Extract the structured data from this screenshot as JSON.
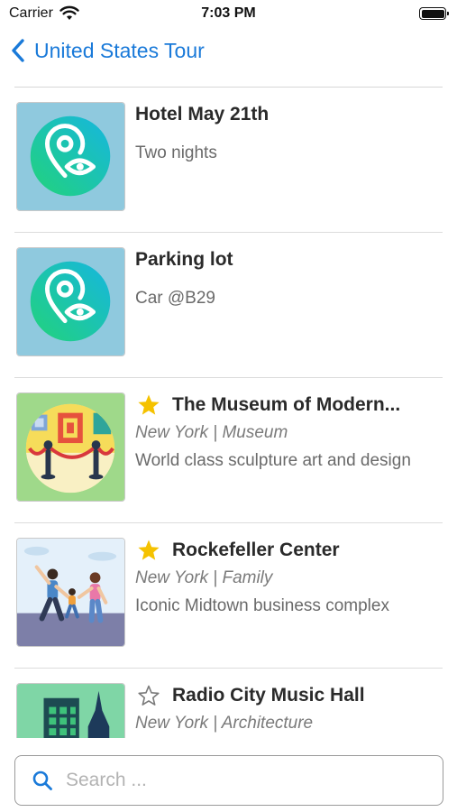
{
  "status": {
    "carrier": "Carrier",
    "time": "7:03 PM"
  },
  "nav": {
    "back_label": "United States Tour"
  },
  "items": [
    {
      "title": "Hotel May 21th",
      "subtitle": "Two nights",
      "icon": "location-eye-icon",
      "starred": null
    },
    {
      "title": "Parking lot",
      "subtitle": "Car @B29",
      "icon": "location-eye-icon",
      "starred": null
    },
    {
      "title": "The Museum of Modern...",
      "meta": "New York | Museum",
      "description": "World class sculpture art and design",
      "icon": "museum-icon",
      "starred": true
    },
    {
      "title": "Rockefeller Center",
      "meta": "New York | Family",
      "description": "Iconic Midtown business complex",
      "icon": "family-icon",
      "starred": true
    },
    {
      "title": "Radio City Music Hall",
      "meta": "New York | Architecture",
      "description": "",
      "icon": "city-icon",
      "starred": false
    }
  ],
  "search": {
    "placeholder": "Search ..."
  },
  "colors": {
    "accent": "#1a7ad9",
    "star": "#f5c200"
  }
}
